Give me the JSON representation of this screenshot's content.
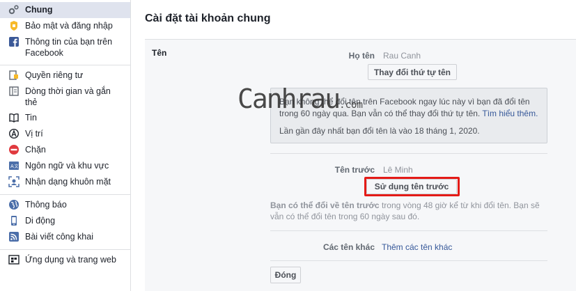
{
  "sidebar": {
    "groups": [
      {
        "items": [
          {
            "label": "Chung",
            "icon": "gears-icon",
            "active": true
          },
          {
            "label": "Bảo mật và đăng nhập",
            "icon": "badge-icon"
          },
          {
            "label": "Thông tin của bạn trên Facebook",
            "icon": "facebook-icon"
          }
        ]
      },
      {
        "items": [
          {
            "label": "Quyền riêng tư",
            "icon": "lock-icon"
          },
          {
            "label": "Dòng thời gian và gắn thẻ",
            "icon": "timeline-icon"
          },
          {
            "label": "Tin",
            "icon": "book-icon"
          },
          {
            "label": "Vị trí",
            "icon": "location-icon"
          },
          {
            "label": "Chặn",
            "icon": "block-icon"
          },
          {
            "label": "Ngôn ngữ và khu vực",
            "icon": "language-icon"
          },
          {
            "label": "Nhận dạng khuôn mặt",
            "icon": "face-recognition-icon"
          }
        ]
      },
      {
        "items": [
          {
            "label": "Thông báo",
            "icon": "globe-icon"
          },
          {
            "label": "Di động",
            "icon": "mobile-icon"
          },
          {
            "label": "Bài viết công khai",
            "icon": "rss-icon"
          }
        ]
      },
      {
        "items": [
          {
            "label": "Ứng dụng và trang web",
            "icon": "apps-icon"
          }
        ]
      }
    ]
  },
  "main": {
    "title": "Cài đặt tài khoản chung",
    "section_label": "Tên",
    "full_name_label": "Họ tên",
    "full_name_value": "Rau Canh",
    "change_order_button": "Thay đổi thứ tự tên",
    "info_line1": "Bạn không thể đổi tên trên Facebook ngay lúc này vì bạn đã đổi tên trong 60 ngày qua. Bạn vẫn có thể thay đổi thứ tự tên.",
    "info_link": "Tìm hiểu thêm.",
    "info_line2": "Lần gần đây nhất bạn đổi tên là vào 18 tháng 1, 2020.",
    "previous_name_label": "Tên trước",
    "previous_name_value": "Lê Minh",
    "use_previous_button": "Sử dụng tên trước",
    "help_bold": "Bạn có thể đổi về tên trước",
    "help_rest": "trong vòng 48 giờ kể từ khi đổi tên. Bạn sẽ vẫn có thể đổi tên trong 60 ngày sau đó.",
    "other_names_label": "Các tên khác",
    "other_names_link": "Thêm các tên khác",
    "close_button": "Đóng"
  },
  "watermark": {
    "text": "Canhrau",
    "domain": ".com"
  },
  "colors": {
    "sidebar_active_bg": "#dfe3ee",
    "link": "#365899",
    "highlight_border": "#e41b17",
    "page_bg": "#e9ebee"
  }
}
